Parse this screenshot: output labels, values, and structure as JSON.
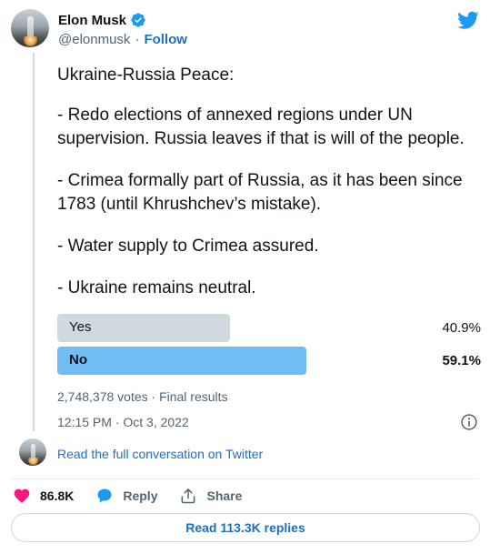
{
  "header": {
    "name": "Elon Musk",
    "handle": "@elonmusk",
    "separator": "·",
    "follow_label": "Follow"
  },
  "tweet": {
    "paragraphs": [
      "Ukraine-Russia Peace:",
      "- Redo elections of annexed regions under UN supervision. Russia leaves if that is will of the people.",
      "- Crimea formally part of Russia, as it has been since 1783 (until Khrushchev’s mistake).",
      "- Water supply to Crimea assured.",
      "- Ukraine remains neutral."
    ]
  },
  "poll": {
    "options": [
      {
        "label": "Yes",
        "percent_text": "40.9%",
        "share": 0.409,
        "color": "#cfd9de",
        "winner": false
      },
      {
        "label": "No",
        "percent_text": "59.1%",
        "share": 0.591,
        "color": "#71bdf3",
        "winner": true
      }
    ],
    "votes_text": "2,748,378 votes · Final results"
  },
  "timestamp": "12:15 PM · Oct 3, 2022",
  "read_conversation": "Read the full conversation on Twitter",
  "actions": {
    "likes_count": "86.8K",
    "reply_label": "Reply",
    "share_label": "Share"
  },
  "read_replies": "Read 113.3K replies",
  "colors": {
    "brand": "#1d9bf0",
    "link": "#1d6fbf",
    "like": "#f91880"
  }
}
